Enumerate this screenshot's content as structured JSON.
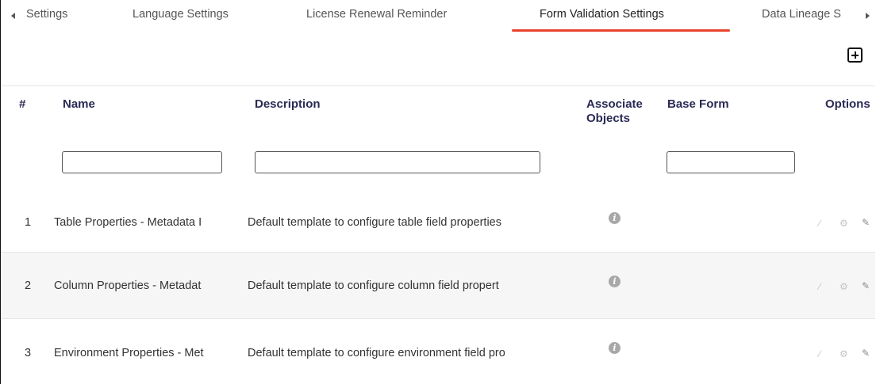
{
  "tabs": [
    {
      "label": "Settings"
    },
    {
      "label": "Language Settings"
    },
    {
      "label": "License Renewal Reminder"
    },
    {
      "label": "Form Validation Settings",
      "active": true
    },
    {
      "label": "Data Lineage S"
    }
  ],
  "table": {
    "headers": {
      "index": "#",
      "name": "Name",
      "description": "Description",
      "associate_line1": "Associate",
      "associate_line2": "Objects",
      "base_form": "Base Form",
      "options": "Options"
    },
    "filters": {
      "name": "",
      "description": "",
      "base_form": ""
    },
    "rows": [
      {
        "index": "1",
        "name": "Table Properties - Metadata I",
        "description": "Default template to configure table field properties"
      },
      {
        "index": "2",
        "name": "Column Properties - Metadat",
        "description": "Default template to configure column field propert"
      },
      {
        "index": "3",
        "name": "Environment Properties - Met",
        "description": "Default template to configure environment field pro"
      }
    ]
  },
  "icons": {
    "info": "info-icon",
    "link": "link-icon",
    "gear": "gear-icon",
    "edit": "edit-icon",
    "add": "add-icon"
  },
  "colors": {
    "accent": "#e8412c",
    "header_text": "#2a2a55",
    "alt_row": "#f6f6f6"
  }
}
